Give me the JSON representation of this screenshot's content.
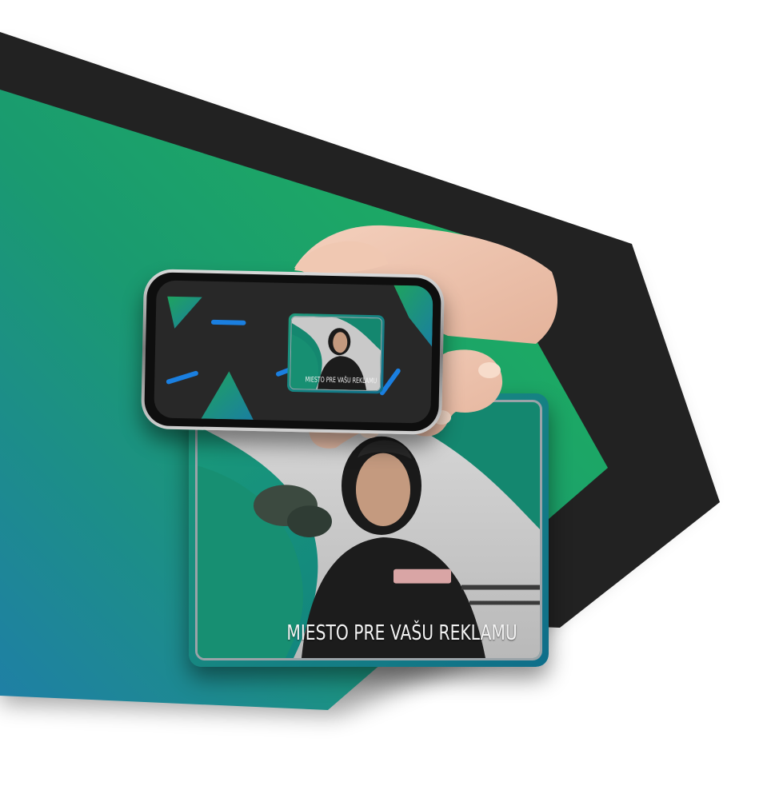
{
  "ad": {
    "caption": "MIESTO PRE VAŠU REKLAMU"
  },
  "phone": {
    "mini_caption": "MIESTO PRE VAŠU REKLAMU"
  },
  "colors": {
    "green_bright": "#1eb45a",
    "teal": "#1a8f84",
    "blue_teal": "#1f7fa0",
    "dark_band": "#222222",
    "screen_bg": "#282828",
    "accent_blue": "#1a7fe0"
  },
  "icons": {
    "decor_triangles": "triangle-shapes",
    "decor_pills": "pill-shapes"
  }
}
